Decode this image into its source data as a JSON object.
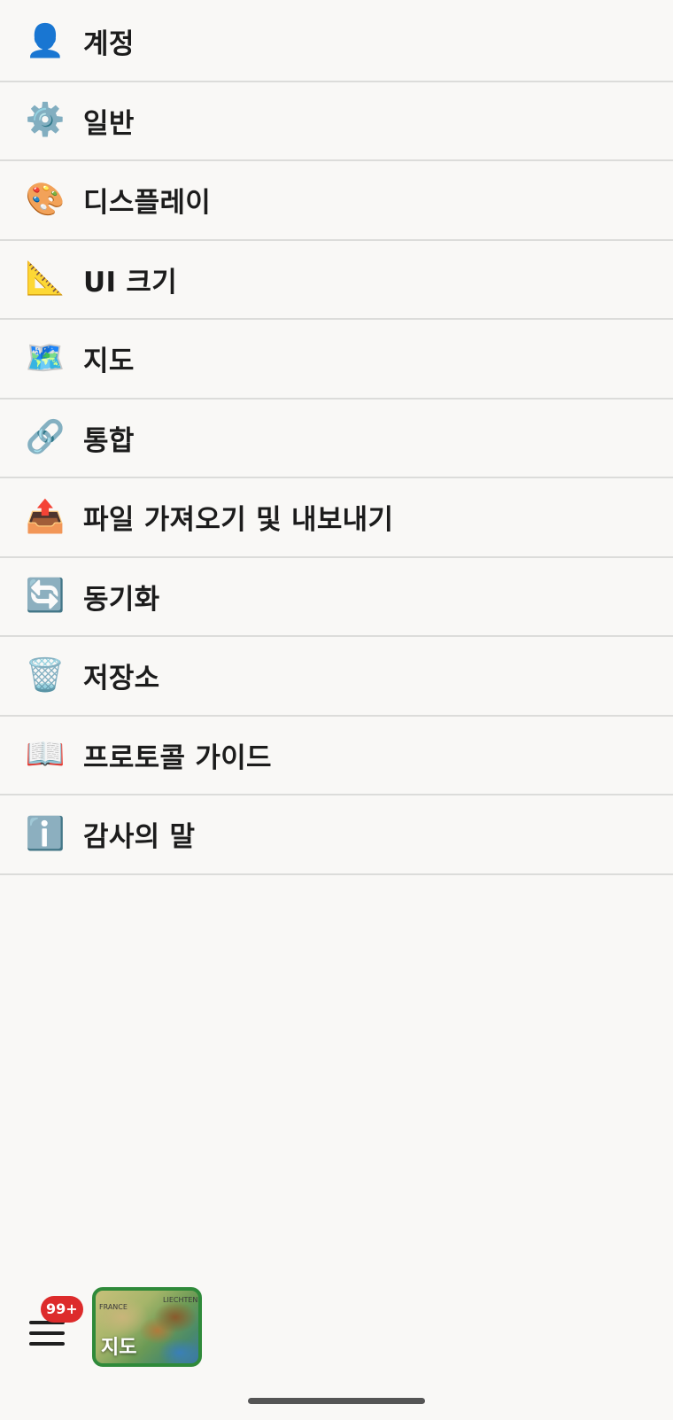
{
  "menu": {
    "items": [
      {
        "icon": "👤",
        "icon_name": "user-silhouette-icon",
        "label": "계정"
      },
      {
        "icon": "⚙️",
        "icon_name": "gear-icon",
        "label": "일반"
      },
      {
        "icon": "🎨",
        "icon_name": "palette-icon",
        "label": "디스플레이"
      },
      {
        "icon": "📐",
        "icon_name": "triangular-ruler-icon",
        "label": "UI 크기"
      },
      {
        "icon": "🗺️",
        "icon_name": "world-map-icon",
        "label": "지도"
      },
      {
        "icon": "🔗",
        "icon_name": "link-icon",
        "label": "통합"
      },
      {
        "icon": "📤",
        "icon_name": "outbox-tray-icon",
        "label": "파일 가져오기 및 내보내기"
      },
      {
        "icon": "🔄",
        "icon_name": "sync-arrows-icon",
        "label": "동기화"
      },
      {
        "icon": "🗑️",
        "icon_name": "wastebasket-icon",
        "label": "저장소"
      },
      {
        "icon": "📖",
        "icon_name": "open-book-icon",
        "label": "프로토콜 가이드"
      },
      {
        "icon": "ℹ️",
        "icon_name": "information-icon",
        "label": "감사의 말"
      }
    ]
  },
  "bottom_bar": {
    "badge": "99+",
    "map_thumbnail": {
      "label": "지도",
      "tiny_labels": [
        "FRANCE",
        "LIECHTENS"
      ]
    }
  },
  "colors": {
    "background": "#f9f8f6",
    "divider": "#dcdcda",
    "badge": "#dd2b2b",
    "thumbnail_border": "#2f8a3a"
  }
}
